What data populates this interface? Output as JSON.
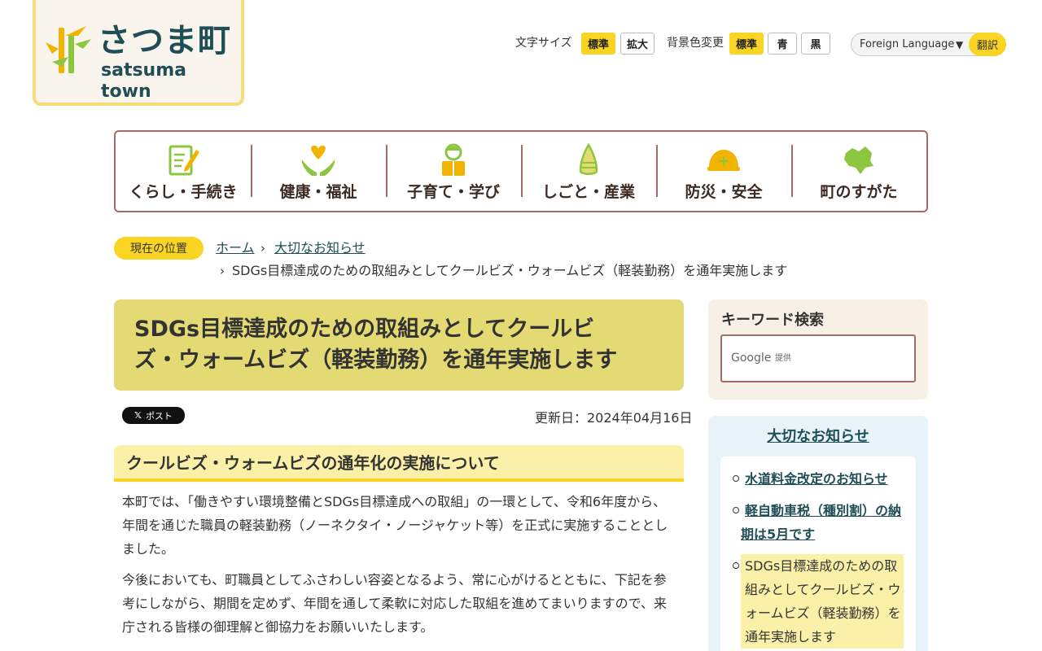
{
  "header": {
    "logo_jp": "さつま町",
    "logo_en": "satsuma town",
    "font_size_label": "文字サイズ",
    "font_size_options": [
      "標準",
      "拡大"
    ],
    "bg_color_label": "背景色変更",
    "bg_color_options": [
      "標準",
      "青",
      "黒"
    ],
    "language_select": "Foreign Language",
    "translate_button": "翻訳"
  },
  "gnav": {
    "items": [
      {
        "label": "くらし・手続き",
        "icon": "document-pen-icon"
      },
      {
        "label": "健康・福祉",
        "icon": "heart-hands-icon"
      },
      {
        "label": "子育て・学び",
        "icon": "child-book-icon"
      },
      {
        "label": "しごと・産業",
        "icon": "bamboo-shoot-icon"
      },
      {
        "label": "防災・安全",
        "icon": "helmet-icon"
      },
      {
        "label": "町のすがた",
        "icon": "town-map-icon"
      }
    ]
  },
  "breadcrumb": {
    "badge": "現在の位置",
    "home": "ホーム",
    "category": "大切なお知らせ",
    "current": "SDGs目標達成のための取組みとしてクールビズ・ウォームビズ（軽装勤務）を通年実施します"
  },
  "main": {
    "title_line1": "SDGs目標達成のための取組みとしてクールビ",
    "title_line2": "ズ・ウォームビズ（軽装勤務）を通年実施します",
    "x_post": "ポスト",
    "updated": "更新日：2024年04月16日",
    "h2": "クールビズ・ウォームビズの通年化の実施について",
    "para1_lines": [
      "本町では、「働きやすい環境整備とSDGs目標達成への取組」の一環として、令和6年度から、",
      "年間を通じた職員の軽装勤務（ノーネクタイ・ノージャケット等）を正式に実施することとし",
      "ました。"
    ],
    "para2_lines": [
      "今後においても、町職員としてふさわしい容姿となるよう、常に心がけるとともに、下記を参",
      "考にしながら、期間を定めず、年間を通して柔軟に対応した取組を進めてまいりますので、来",
      "庁される皆様の御理解と御協力をお願いいたします。"
    ]
  },
  "sidebar": {
    "search_title": "キーワード検索",
    "search_brand": "Google",
    "search_brand_sub": "提供",
    "notice_title": "大切なお知らせ",
    "notices": [
      {
        "lines": [
          "水道料金改定のお知らせ"
        ]
      },
      {
        "lines": [
          "軽自動車税（種別割）の納",
          "期は5月です"
        ]
      },
      {
        "lines": [
          "SDGs目標達成のための取",
          "組みとしてクールビズ・ウ",
          "ォームビズ（軽装勤務）を",
          "通年実施します"
        ]
      }
    ]
  },
  "colors": {
    "accent_yellow": "#f9d422",
    "nav_border": "#a76a6a",
    "title_bg": "#e4da73",
    "link": "#1f4e57"
  }
}
